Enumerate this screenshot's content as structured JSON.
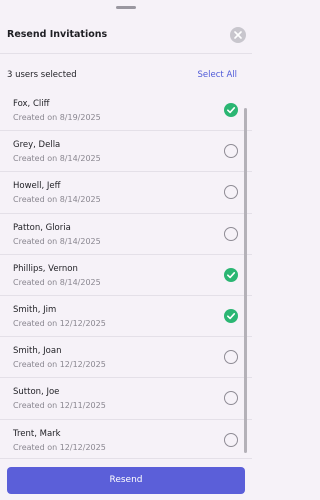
{
  "dialog": {
    "title": "Resend Invitations",
    "close_icon": "close-icon"
  },
  "selection": {
    "count_text": "3 users selected",
    "select_all_label": "Select All"
  },
  "users": [
    {
      "name": "Fox, Cliff",
      "created": "Created on 8/19/2025",
      "selected": true
    },
    {
      "name": "Grey, Della",
      "created": "Created on 8/14/2025",
      "selected": false
    },
    {
      "name": "Howell, Jeff",
      "created": "Created on 8/14/2025",
      "selected": false
    },
    {
      "name": "Patton, Gloria",
      "created": "Created on 8/14/2025",
      "selected": false
    },
    {
      "name": "Phillips, Vernon",
      "created": "Created on 8/14/2025",
      "selected": true
    },
    {
      "name": "Smith, Jim",
      "created": "Created on 12/12/2025",
      "selected": true
    },
    {
      "name": "Smith, Joan",
      "created": "Created on 12/12/2025",
      "selected": false
    },
    {
      "name": "Sutton, Joe",
      "created": "Created on 12/11/2025",
      "selected": false
    },
    {
      "name": "Trent, Mark",
      "created": "Created on 12/12/2025",
      "selected": false
    }
  ],
  "footer": {
    "resend_label": "Resend"
  },
  "colors": {
    "accent": "#5b5fd9",
    "link": "#4f5ad8",
    "selected_check": "#2bb673",
    "background": "#f6f2f8"
  }
}
